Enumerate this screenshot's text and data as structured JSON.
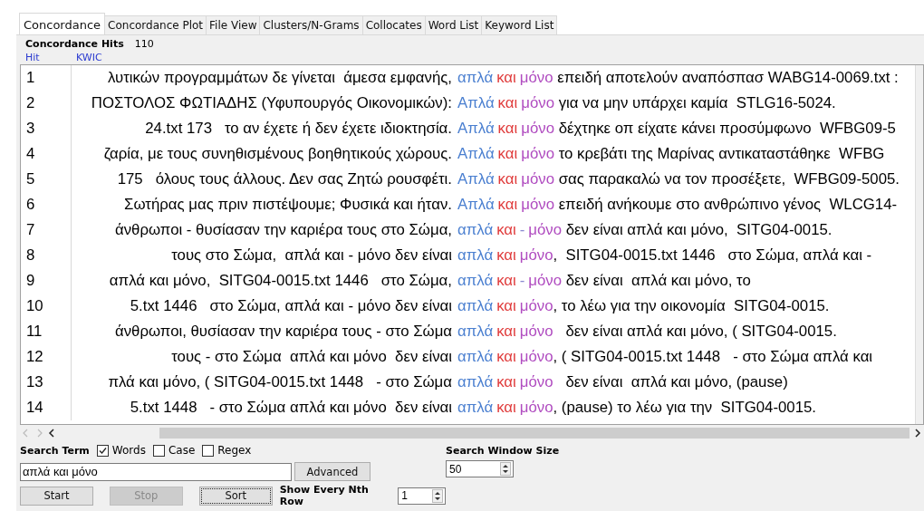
{
  "tabs": [
    {
      "label": "Concordance",
      "selected": true
    },
    {
      "label": "Concordance Plot",
      "selected": false
    },
    {
      "label": "File View",
      "selected": false
    },
    {
      "label": "Clusters/N-Grams",
      "selected": false
    },
    {
      "label": "Collocates",
      "selected": false
    },
    {
      "label": "Word List",
      "selected": false
    },
    {
      "label": "Keyword List",
      "selected": false
    }
  ],
  "hits": {
    "label": "Concordance Hits",
    "count": "110"
  },
  "table": {
    "columns": [
      "Hit",
      "KWIC"
    ],
    "rows": [
      {
        "hit": "1",
        "left": "λυτικών προγραμμάτων δε γίνεται  άμεσα εμφανής,",
        "key": [
          {
            "text": "απλά",
            "color": "#4a7fd0"
          },
          {
            "text": "και",
            "color": "#e03c3c"
          },
          {
            "text": "μόνο",
            "color": "#b04cc0"
          }
        ],
        "right": "επειδή αποτελούν αναπόσπασ WABG14-0069.txt :"
      },
      {
        "hit": "2",
        "left": "ΠΟΣΤΟΛΟΣ ΦΩΤΙΑΔΗΣ (Υφυπουργός Οικονομικών):",
        "key": [
          {
            "text": "Απλά",
            "color": "#4a7fd0"
          },
          {
            "text": "και",
            "color": "#e03c3c"
          },
          {
            "text": "μόνο",
            "color": "#b04cc0"
          }
        ],
        "right": "για να μην υπάρχει καμία  STLG16-5024."
      },
      {
        "hit": "3",
        "left": "24.txt 173   το αν έχετε ή δεν έχετε ιδιοκτησία.",
        "key": [
          {
            "text": "Απλά",
            "color": "#4a7fd0"
          },
          {
            "text": "και",
            "color": "#e03c3c"
          },
          {
            "text": "μόνο",
            "color": "#b04cc0"
          }
        ],
        "right": "δέχτηκε οπ είχατε κάνει προσύμφωνο  WFBG09-5"
      },
      {
        "hit": "4",
        "left": "ζαρία, με τους συνηθισμένους βοηθητικούς χώρους.",
        "key": [
          {
            "text": "Απλά",
            "color": "#4a7fd0"
          },
          {
            "text": "και",
            "color": "#e03c3c"
          },
          {
            "text": "μόνο",
            "color": "#b04cc0"
          }
        ],
        "right": "το κρεβάτι της Μαρίνας αντικαταστάθηκε  WFBG"
      },
      {
        "hit": "5",
        "left": "175   όλους τους άλλους. Δεν σας Ζητώ ρουσφέτι.",
        "key": [
          {
            "text": "Απλά",
            "color": "#4a7fd0"
          },
          {
            "text": "και",
            "color": "#e03c3c"
          },
          {
            "text": "μόνο",
            "color": "#b04cc0"
          }
        ],
        "right": "σας παρακαλώ να τον προσέξετε,  WFBG09-5005."
      },
      {
        "hit": "6",
        "left": "Σωτήρας μας πριν πιστέψουμε; Φυσικά και ήταν.",
        "key": [
          {
            "text": "Απλά",
            "color": "#4a7fd0"
          },
          {
            "text": "και",
            "color": "#e03c3c"
          },
          {
            "text": "μόνο",
            "color": "#b04cc0"
          }
        ],
        "right": "επειδή ανήκουμε στο ανθρώπινο γένος  WLCG14-"
      },
      {
        "hit": "7",
        "left": "άνθρωποι - θυσίασαν την καριέρα τους στο Σώμα,",
        "key": [
          {
            "text": "απλά",
            "color": "#4a7fd0"
          },
          {
            "text": "και",
            "color": "#e03c3c"
          },
          {
            "text": "-",
            "color": "#8a8ad0"
          },
          {
            "text": "μόνο",
            "color": "#b04cc0"
          }
        ],
        "right": "δεν είναι απλά και μόνο,  SITG04-0015."
      },
      {
        "hit": "8",
        "left": "τους στο Σώμα,  απλά και - μόνο δεν είναι",
        "key": [
          {
            "text": "απλά",
            "color": "#4a7fd0"
          },
          {
            "text": "και",
            "color": "#e03c3c"
          },
          {
            "text": "μόνο",
            "color": "#b04cc0"
          }
        ],
        "right": ",  SITG04-0015.txt 1446   στο Σώμα, απλά και -"
      },
      {
        "hit": "9",
        "left": "απλά και μόνο,  SITG04-0015.txt 1446   στο Σώμα,",
        "key": [
          {
            "text": "απλά",
            "color": "#4a7fd0"
          },
          {
            "text": "και",
            "color": "#e03c3c"
          },
          {
            "text": "-",
            "color": "#8a8ad0"
          },
          {
            "text": "μόνο",
            "color": "#b04cc0"
          }
        ],
        "right": "δεν είναι  απλά και μόνο, το"
      },
      {
        "hit": "10",
        "left": "5.txt 1446   στο Σώμα, απλά και - μόνο δεν είναι",
        "key": [
          {
            "text": "απλά",
            "color": "#4a7fd0"
          },
          {
            "text": "και",
            "color": "#e03c3c"
          },
          {
            "text": "μόνο",
            "color": "#b04cc0"
          }
        ],
        "right": ", το λέω για την οικονομία  SITG04-0015."
      },
      {
        "hit": "11",
        "left": "άνθρωποι, θυσίασαν την καριέρα τους - στο Σώμα",
        "key": [
          {
            "text": "απλά",
            "color": "#4a7fd0"
          },
          {
            "text": "και",
            "color": "#e03c3c"
          },
          {
            "text": "μόνο",
            "color": "#b04cc0"
          }
        ],
        "right": "  δεν είναι απλά και μόνο, ( SITG04-0015."
      },
      {
        "hit": "12",
        "left": "τους - στο Σώμα  απλά και μόνο  δεν είναι",
        "key": [
          {
            "text": "απλά",
            "color": "#4a7fd0"
          },
          {
            "text": "και",
            "color": "#e03c3c"
          },
          {
            "text": "μόνο",
            "color": "#b04cc0"
          }
        ],
        "right": ", ( SITG04-0015.txt 1448   - στο Σώμα απλά και"
      },
      {
        "hit": "13",
        "left": "πλά και μόνο, ( SITG04-0015.txt 1448   - στο Σώμα",
        "key": [
          {
            "text": "απλά",
            "color": "#4a7fd0"
          },
          {
            "text": "και",
            "color": "#e03c3c"
          },
          {
            "text": "μόνο",
            "color": "#b04cc0"
          }
        ],
        "right": "  δεν είναι  απλά και μόνο, (pause)"
      },
      {
        "hit": "14",
        "left": "5.txt 1448   - στο Σώμα απλά και μόνο  δεν είναι",
        "key": [
          {
            "text": "απλά",
            "color": "#4a7fd0"
          },
          {
            "text": "και",
            "color": "#e03c3c"
          },
          {
            "text": "μόνο",
            "color": "#b04cc0"
          }
        ],
        "right": ", (pause) το λέω για την  SITG04-0015."
      }
    ]
  },
  "search": {
    "label": "Search Term",
    "options": [
      {
        "label": "Words",
        "checked": true
      },
      {
        "label": "Case",
        "checked": false
      },
      {
        "label": "Regex",
        "checked": false
      }
    ],
    "value": "απλά και μόνο",
    "advanced": "Advanced",
    "window_label": "Search Window Size",
    "window_value": "50"
  },
  "buttons": [
    {
      "label": "Start",
      "disabled": false,
      "focused": false
    },
    {
      "label": "Stop",
      "disabled": true,
      "focused": false
    },
    {
      "label": "Sort",
      "disabled": false,
      "focused": true
    }
  ],
  "nth": {
    "label": "Show Every Nth Row",
    "value": "1"
  }
}
